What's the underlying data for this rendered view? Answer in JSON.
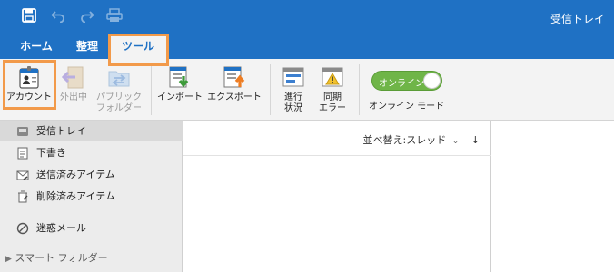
{
  "window": {
    "title": "受信トレイ"
  },
  "quick_access": [
    {
      "icon": "save-icon"
    },
    {
      "icon": "undo-icon"
    },
    {
      "icon": "redo-icon"
    },
    {
      "icon": "print-icon"
    }
  ],
  "tabs": [
    {
      "label": "ホーム"
    },
    {
      "label": "整理"
    },
    {
      "label": "ツール",
      "active": true
    }
  ],
  "ribbon": {
    "account": "アカウント",
    "out_of_office": "外出中",
    "public_folder_1": "パブリック",
    "public_folder_2": "フォルダー",
    "import": "インポート",
    "export": "エクスポート",
    "progress_1": "進行",
    "progress_2": "状況",
    "sync_error_1": "同期",
    "sync_error_2": "エラー",
    "online_toggle": "オンライン",
    "online_mode_label": "オンライン モード"
  },
  "sidebar": {
    "items": [
      {
        "label": "受信トレイ",
        "icon": "inbox-icon",
        "selected": true
      },
      {
        "label": "下書き",
        "icon": "drafts-icon"
      },
      {
        "label": "送信済みアイテム",
        "icon": "sent-icon"
      },
      {
        "label": "削除済みアイテム",
        "icon": "trash-icon"
      },
      {
        "label": "迷惑メール",
        "icon": "junk-icon"
      }
    ],
    "smart_folders": "スマート フォルダー"
  },
  "list": {
    "sort_label": "並べ替え:スレッド"
  },
  "colors": {
    "accent": "#1f71c4",
    "highlight": "#f29a4a",
    "toggle_on": "#6fb548"
  }
}
